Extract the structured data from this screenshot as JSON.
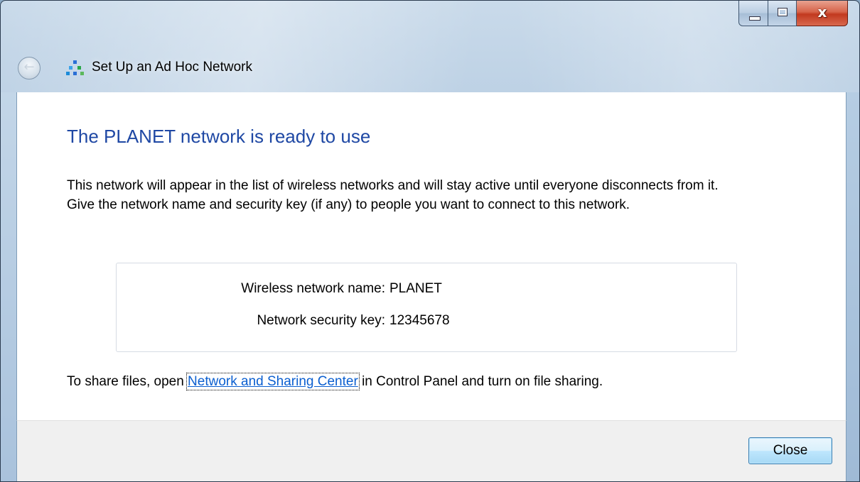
{
  "window": {
    "title": "Set Up an Ad Hoc Network",
    "controls": {
      "minimize_icon": "minimize-icon",
      "maximize_icon": "maximize-icon",
      "close_glyph": "x"
    },
    "accent": "#1f48a4"
  },
  "nav": {
    "back_icon": "back-arrow-icon",
    "app_icon": "adhoc-network-icon"
  },
  "content": {
    "heading": "The PLANET network is ready to use",
    "description": "This network will appear in the list of wireless networks and will stay active until everyone disconnects from it. Give the network name and security key (if any) to people you want to connect to this network.",
    "info": {
      "name_label": "Wireless network name:",
      "name_value": "PLANET",
      "key_label": "Network security key:",
      "key_value": "12345678"
    },
    "share": {
      "prefix": "To share files, open ",
      "link": "Network and Sharing Center",
      "suffix": " in Control Panel and turn on file sharing."
    }
  },
  "footer": {
    "close_label": "Close"
  }
}
